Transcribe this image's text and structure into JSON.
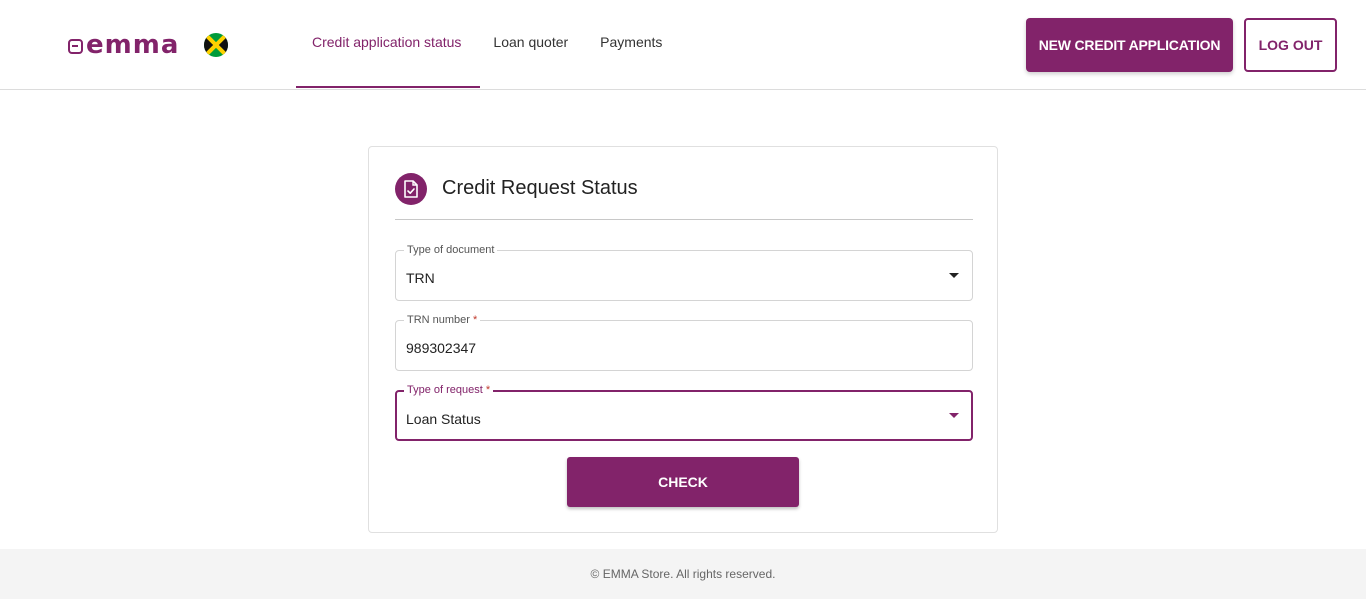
{
  "header": {
    "logo_text": "emma",
    "flag": "jamaica-flag-icon",
    "nav": [
      {
        "label": "Credit application status",
        "active": true
      },
      {
        "label": "Loan quoter",
        "active": false
      },
      {
        "label": "Payments",
        "active": false
      }
    ],
    "new_application_label": "NEW CREDIT APPLICATION",
    "logout_label": "LOG OUT"
  },
  "card": {
    "icon": "document-check-icon",
    "title": "Credit Request Status",
    "fields": {
      "document_type": {
        "label": "Type of document",
        "value": "TRN"
      },
      "trn_number": {
        "label": "TRN number",
        "required_mark": "*",
        "value": "989302347"
      },
      "request_type": {
        "label": "Type of request",
        "required_mark": "*",
        "value": "Loan Status"
      }
    },
    "check_label": "CHECK"
  },
  "footer": {
    "text": "© EMMA Store. All rights reserved."
  },
  "colors": {
    "brand": "#82236a",
    "footer_bg": "#f4f4f4"
  }
}
